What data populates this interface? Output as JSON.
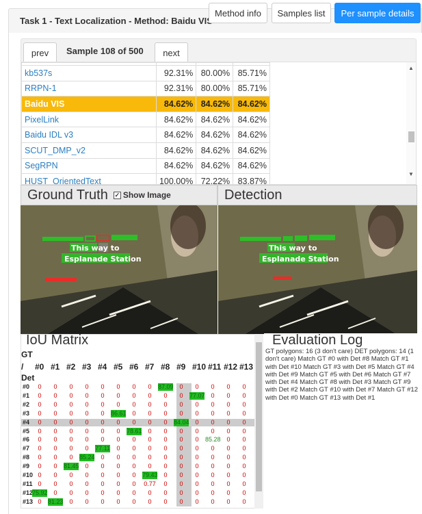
{
  "header": {
    "title": "Task 1 - Text Localization - Method: Baidu VIS",
    "tabs": [
      "Method info",
      "Samples list",
      "Per sample details"
    ]
  },
  "sample_nav": {
    "prev": "prev",
    "label": "Sample 108 of 500",
    "next": "next"
  },
  "ranking": {
    "rows": [
      {
        "name": "kb537s",
        "a": "92.31%",
        "b": "80.00%",
        "c": "85.71%"
      },
      {
        "name": "RRPN-1",
        "a": "92.31%",
        "b": "80.00%",
        "c": "85.71%"
      },
      {
        "name": "Baidu VIS",
        "a": "84.62%",
        "b": "84.62%",
        "c": "84.62%"
      },
      {
        "name": "PixelLink",
        "a": "84.62%",
        "b": "84.62%",
        "c": "84.62%"
      },
      {
        "name": "Baidu IDL v3",
        "a": "84.62%",
        "b": "84.62%",
        "c": "84.62%"
      },
      {
        "name": "SCUT_DMP_v2",
        "a": "84.62%",
        "b": "84.62%",
        "c": "84.62%"
      },
      {
        "name": "SegRPN",
        "a": "84.62%",
        "b": "84.62%",
        "c": "84.62%"
      },
      {
        "name": "HUST_OrientedText",
        "a": "100.00%",
        "b": "72.22%",
        "c": "83.87%"
      }
    ]
  },
  "ground_truth": {
    "title": "Ground Truth",
    "show_image": "Show Image"
  },
  "detection": {
    "title": "Detection"
  },
  "photo": {
    "sign_line1": "This way to",
    "sign_line2": "Esplanade Station"
  },
  "iou": {
    "title": "IoU Matrix",
    "gt_label": "GT",
    "slash": "/",
    "det_label": "Det",
    "cols": [
      "#0",
      "#1",
      "#2",
      "#3",
      "#4",
      "#5",
      "#6",
      "#7",
      "#8",
      "#9",
      "#10",
      "#11",
      "#12",
      "#13"
    ],
    "rows": [
      "#0",
      "#1",
      "#2",
      "#3",
      "#4",
      "#5",
      "#6",
      "#7",
      "#8",
      "#9",
      "#10",
      "#11",
      "#12",
      "#13"
    ],
    "values": [
      [
        "0",
        "0",
        "0",
        "0",
        "0",
        "0",
        "0",
        "0",
        "87.09",
        "0",
        "0",
        "0",
        "0",
        "0"
      ],
      [
        "0",
        "0",
        "0",
        "0",
        "0",
        "0",
        "0",
        "0",
        "0",
        "0",
        "77.07",
        "0",
        "0",
        "0"
      ],
      [
        "0",
        "0",
        "0",
        "0",
        "0",
        "0",
        "0",
        "0",
        "0",
        "0",
        "0",
        "0",
        "0",
        "0"
      ],
      [
        "0",
        "0",
        "0",
        "0",
        "0",
        "86.61",
        "0",
        "0",
        "0",
        "0",
        "0",
        "0",
        "0",
        "0"
      ],
      [
        "0",
        "0",
        "0",
        "0",
        "0",
        "0",
        "0",
        "0",
        "0",
        "84.04",
        "0",
        "0",
        "0",
        "0"
      ],
      [
        "0",
        "0",
        "0",
        "0",
        "0",
        "0",
        "78.61",
        "0",
        "0",
        "0",
        "0",
        "0",
        "0",
        "0"
      ],
      [
        "0",
        "0",
        "0",
        "0",
        "0",
        "0",
        "0",
        "0",
        "0",
        "0",
        "0",
        "85.28",
        "0",
        "0"
      ],
      [
        "0",
        "0",
        "0",
        "0",
        "77.11",
        "0",
        "0",
        "0",
        "0",
        "0",
        "0",
        "0",
        "0",
        "0"
      ],
      [
        "0",
        "0",
        "0",
        "85.24",
        "0",
        "0",
        "0",
        "0",
        "0",
        "0",
        "0",
        "0",
        "0",
        "0"
      ],
      [
        "0",
        "0",
        "81.45",
        "0",
        "0",
        "0",
        "0",
        "0",
        "0",
        "0",
        "0",
        "0",
        "0",
        "0"
      ],
      [
        "0",
        "0",
        "0",
        "0",
        "0",
        "0",
        "0",
        "79.43",
        "0",
        "0",
        "0",
        "0",
        "0",
        "0"
      ],
      [
        "0",
        "0",
        "0",
        "0",
        "0",
        "0",
        "0",
        "0.77",
        "0",
        "0",
        "0",
        "0",
        "0",
        "0"
      ],
      [
        "75.92",
        "0",
        "0",
        "0",
        "0",
        "0",
        "0",
        "0",
        "0",
        "0",
        "0",
        "0",
        "0",
        "0"
      ],
      [
        "0",
        "81.23",
        "0",
        "0",
        "0",
        "0",
        "0",
        "0",
        "0",
        "0",
        "0",
        "0",
        "0",
        "0"
      ]
    ]
  },
  "log": {
    "title": "Evaluation Log",
    "text": "GT polygons: 16 (3 don't care) DET polygons: 14 (1 don't care) Match GT #0 with Det #8 Match GT #1 with Det #10 Match GT #3 with Det #5 Match GT #4 with Det #9 Match GT #5 with Det #6 Match GT #7 with Det #4 Match GT #8 with Det #3 Match GT #9 with Det #2 Match GT #10 with Det #7 Match GT #12 with Det #0 Match GT #13 with Det #1"
  }
}
